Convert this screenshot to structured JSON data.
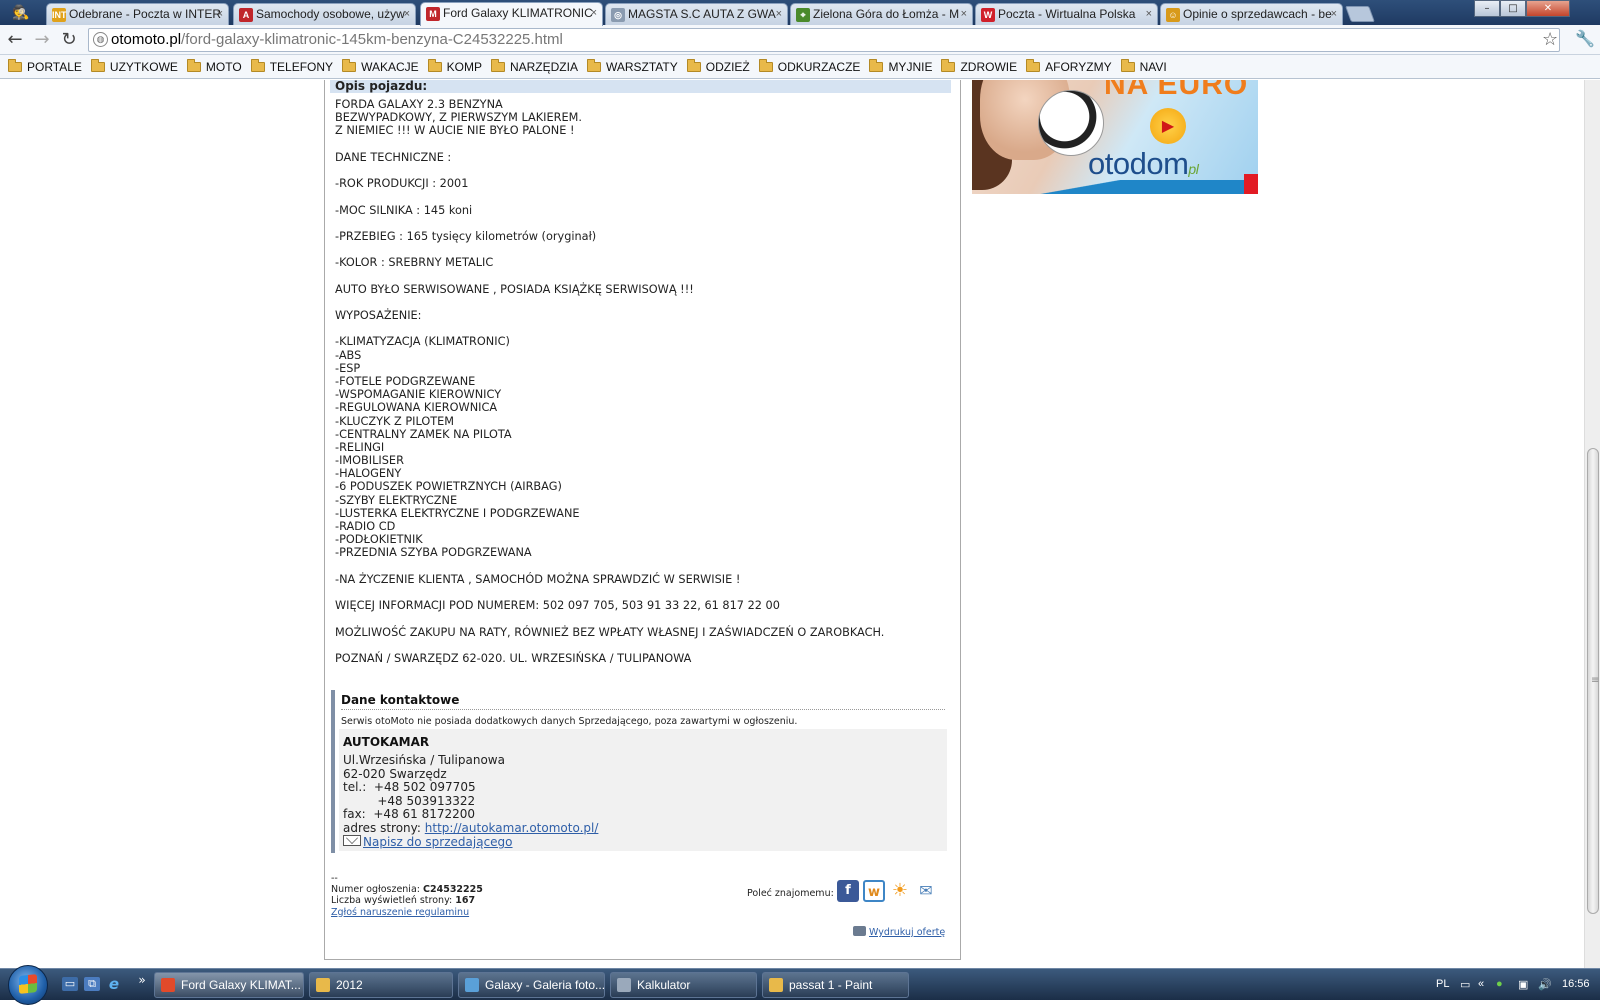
{
  "browser": {
    "tabs": [
      {
        "label": "Odebrane - Poczta w INTER",
        "favicon": "INT",
        "color": "#e0a21b"
      },
      {
        "label": "Samochody osobowe, używ",
        "favicon": "A",
        "color": "#c0262b"
      },
      {
        "label": "Ford Galaxy KLIMATRONIC",
        "favicon": "M",
        "color": "#c0262b",
        "active": true
      },
      {
        "label": "MAGSTA S.C AUTA Z GWA",
        "favicon": "◎",
        "color": "#8a9bb0"
      },
      {
        "label": "Zielona Góra do Łomża - M",
        "favicon": "⌖",
        "color": "#4a8a2b"
      },
      {
        "label": "Poczta - Wirtualna Polska",
        "favicon": "W",
        "color": "#d0202a"
      },
      {
        "label": "Opinie o sprzedawcach - be",
        "favicon": "☺",
        "color": "#d89a1a"
      }
    ],
    "tab_close": "×",
    "window_controls": {
      "minimize": "–",
      "maximize": "□",
      "close": "✕"
    },
    "url_host": "otomoto.pl",
    "url_path": "/ford-galaxy-klimatronic-145km-benzyna-C24532225.html",
    "nav": {
      "back": "←",
      "forward": "→",
      "reload": "↻"
    },
    "star": "☆",
    "wrench": "🔧",
    "bookmarks": [
      "PORTALE",
      "UZYTKOWE",
      "MOTO",
      "TELEFONY",
      "WAKACJE",
      "KOMP",
      "NARZĘDZIA",
      "WARSZTATY",
      "ODZIEŻ",
      "ODKURZACZE",
      "MYJNIE",
      "ZDROWIE",
      "AFORYZMY",
      "NAVI"
    ]
  },
  "listing": {
    "description_heading": "Opis pojazdu:",
    "description_lines": [
      "FORDA GALAXY 2.3 BENZYNA",
      "BEZWYPADKOWY, Z PIERWSZYM LAKIEREM.",
      "Z NIEMIEC !!! W AUCIE NIE BYŁO PALONE !",
      "",
      "DANE TECHNICZNE :",
      "",
      "-ROK PRODUKCJI : 2001",
      "",
      "-MOC SILNIKA : 145 koni",
      "",
      "-PRZEBIEG : 165 tysięcy kilometrów (oryginał)",
      "",
      "-KOLOR : SREBRNY METALIC",
      "",
      "AUTO BYŁO SERWISOWANE , POSIADA KSIĄŻKĘ SERWISOWĄ !!!",
      "",
      "WYPOSAŻENIE:",
      "",
      "-KLIMATYZACJA (KLIMATRONIC)",
      "-ABS",
      "-ESP",
      "-FOTELE PODGRZEWANE",
      "-WSPOMAGANIE KIEROWNICY",
      "-REGULOWANA KIEROWNICA",
      "-KLUCZYK Z PILOTEM",
      "-CENTRALNY ZAMEK NA PILOTA",
      "-RELINGI",
      "-IMOBILISER",
      "-HALOGENY",
      "-6 PODUSZEK POWIETRZNYCH (AIRBAG)",
      "-SZYBY ELEKTRYCZNE",
      "-LUSTERKA ELEKTRYCZNE I PODGRZEWANE",
      "-RADIO CD",
      "-PODŁOKIETNIK",
      "-PRZEDNIA SZYBA PODGRZEWANA",
      "",
      "-NA ŻYCZENIE KLIENTA , SAMOCHÓD MOŻNA SPRAWDZIĆ W SERWISIE !",
      "",
      "WIĘCEJ INFORMACJI POD NUMEREM: 502 097 705, 503 91 33 22, 61 817 22 00",
      "",
      "MOŻLIWOŚĆ ZAKUPU NA RATY, RÓWNIEŻ BEZ WPŁATY WŁASNEJ I ZAŚWIADCZEŃ O ZAROBKACH.",
      "",
      "POZNAŃ / SWARZĘDZ 62-020. UL. WRZESIŃSKA / TULIPANOWA"
    ],
    "contact": {
      "title": "Dane kontaktowe",
      "note": "Serwis otoMoto nie posiada dodatkowych danych Sprzedającego, poza zawartymi w ogłoszeniu.",
      "dealer": "AUTOKAMAR",
      "address1": "Ul.Wrzesińska / Tulipanowa",
      "address2": "62-020 Swarzędz",
      "tel_label": "tel.:",
      "tel1": "+48 502 097705",
      "tel2": "+48 503913322",
      "fax_label": "fax:",
      "fax": "+48 61 8172200",
      "site_label": "adres strony:",
      "site_url": "http://autokamar.otomoto.pl/",
      "write_link": "Napisz do sprzedającego"
    },
    "meta": {
      "separator": "--",
      "ad_number_label": "Numer ogłoszenia:",
      "ad_number": "C24532225",
      "views_label": "Liczba wyświetleń strony:",
      "views": "167",
      "report_link": "Zgłoś naruszenie regulaminu"
    },
    "share_label": "Poleć znajomemu:",
    "share_icons": [
      "facebook-icon",
      "wykop-icon",
      "nasza-klasa-icon",
      "email-icon"
    ],
    "print_link": "Wydrukuj ofertę"
  },
  "ad": {
    "headline": "NA EURO",
    "logo": "otodom",
    "logo_suffix": "pl"
  },
  "taskbar": {
    "buttons": [
      {
        "label": "Ford Galaxy KLIMAT...",
        "color": "#e24a2a",
        "active": true
      },
      {
        "label": "2012",
        "color": "#e8b94a"
      },
      {
        "label": "Galaxy - Galeria foto...",
        "color": "#5aa0d8"
      },
      {
        "label": "Kalkulator",
        "color": "#9aa9bb"
      },
      {
        "label": "passat 1 - Paint",
        "color": "#e8b94a"
      }
    ],
    "show_more": "»",
    "language": "PL",
    "clock": "16:56"
  }
}
